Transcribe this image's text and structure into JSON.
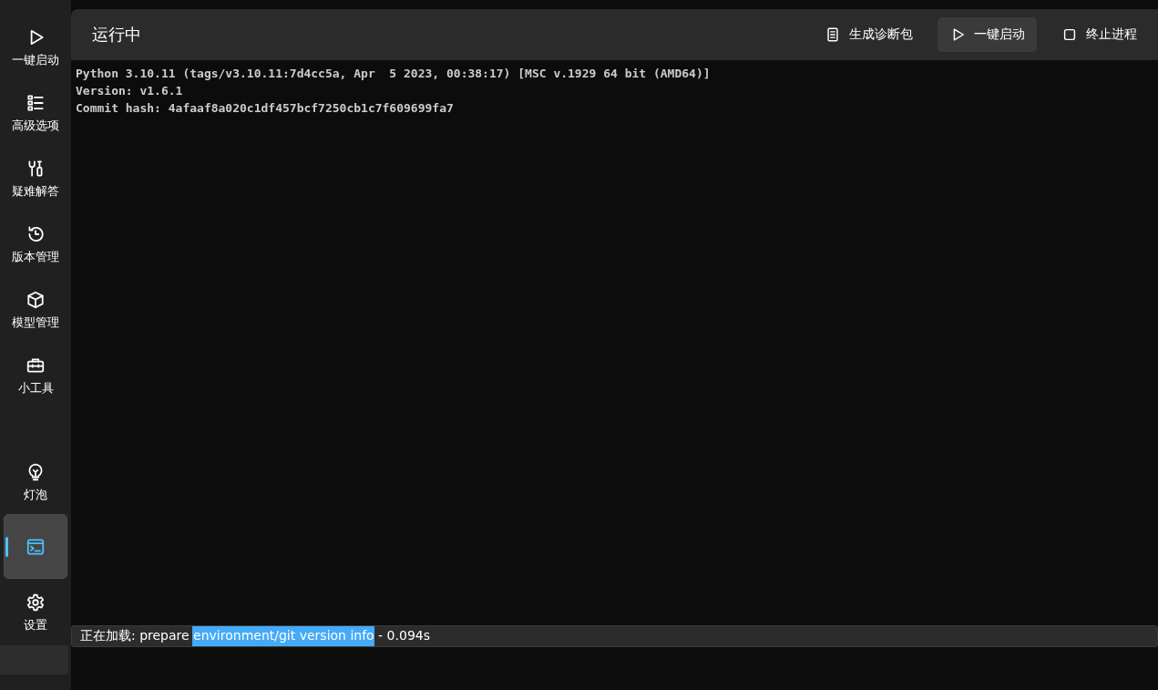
{
  "sidebar": {
    "items": [
      {
        "label": "一键启动",
        "selected": false
      },
      {
        "label": "高级选项",
        "selected": false
      },
      {
        "label": "疑难解答",
        "selected": false
      },
      {
        "label": "版本管理",
        "selected": false
      },
      {
        "label": "模型管理",
        "selected": false
      },
      {
        "label": "小工具",
        "selected": false
      }
    ],
    "bottom_items": [
      {
        "label": "灯泡",
        "selected": false
      },
      {
        "selected": true
      },
      {
        "label": "设置",
        "selected": false
      }
    ]
  },
  "header": {
    "title": "运行中",
    "buttons": [
      {
        "label": "生成诊断包",
        "highlighted": false
      },
      {
        "label": "一键启动",
        "highlighted": true
      },
      {
        "label": "终止进程",
        "highlighted": false
      }
    ]
  },
  "console": {
    "lines": [
      "Python 3.10.11 (tags/v3.10.11:7d4cc5a, Apr  5 2023, 00:38:17) [MSC v.1929 64 bit (AMD64)]",
      "Version: v1.6.1",
      "Commit hash: 4afaaf8a020c1df457bcf7250cb1c7f609699fa7"
    ]
  },
  "status_bar": {
    "text": "正在加载: prepare environment/git version info - 0.094s"
  }
}
